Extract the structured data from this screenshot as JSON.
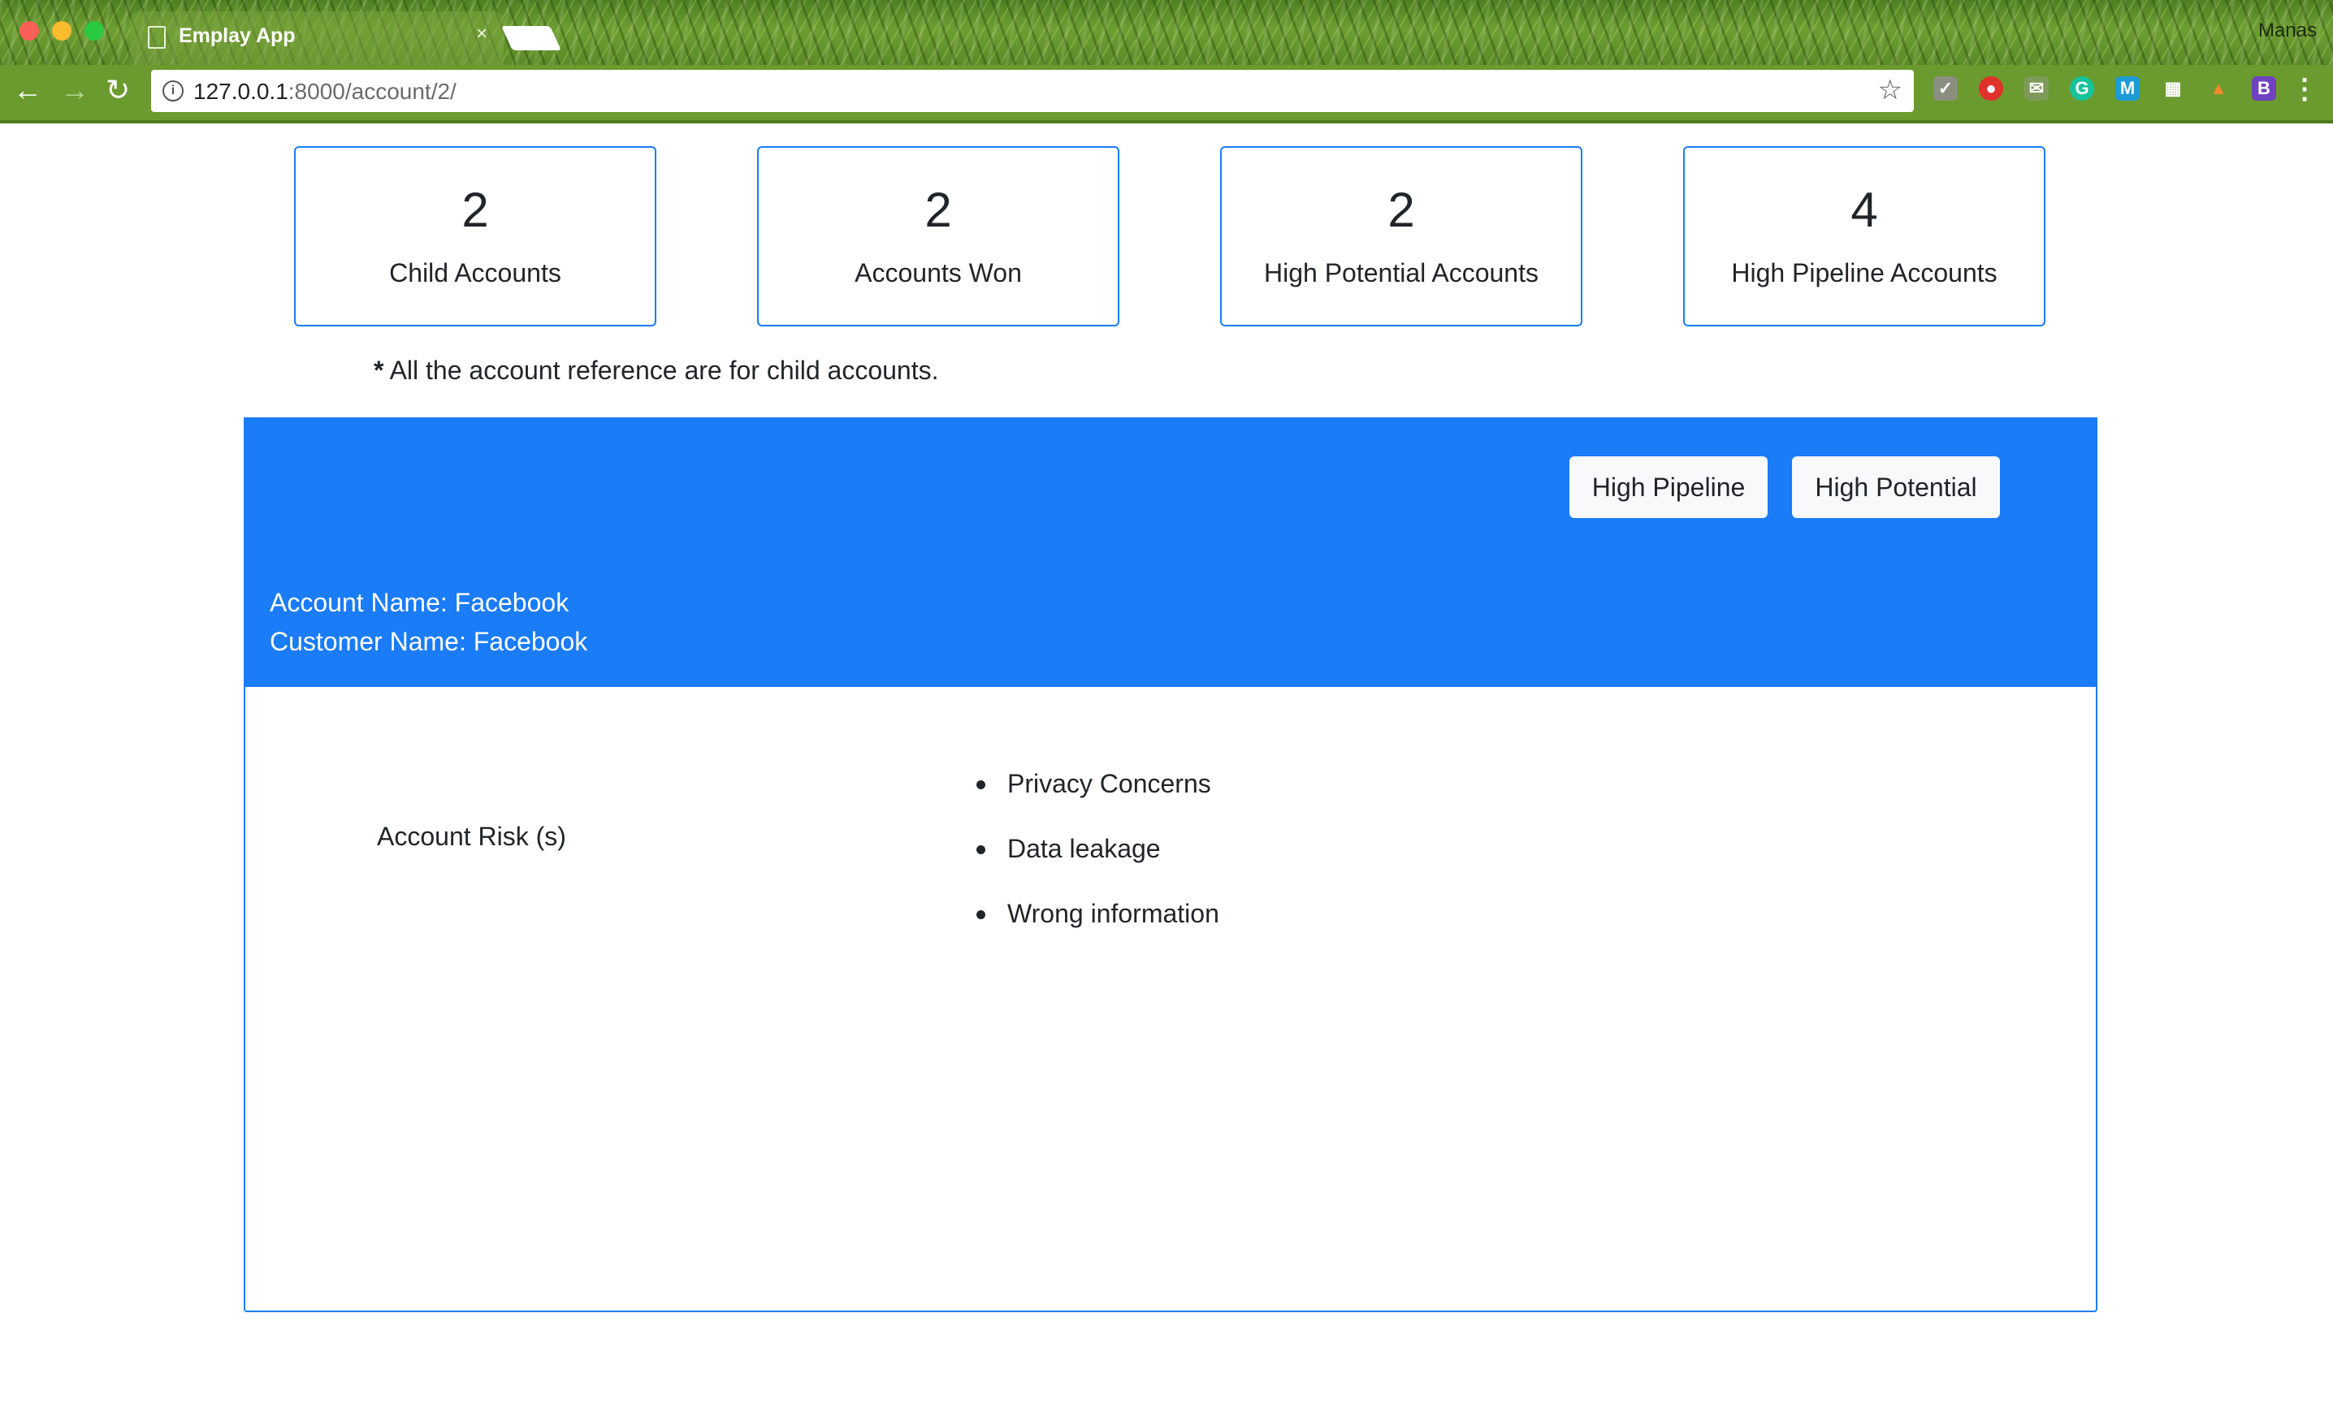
{
  "browser": {
    "tab_title": "Emplay App",
    "tab_close": "×",
    "profile_name": "Manas",
    "url_host": "127.0.0.1",
    "url_rest": ":8000/account/2/",
    "extensions": [
      "pocket-icon",
      "ublock-icon",
      "mail-icon",
      "grammarly-icon",
      "m-icon",
      "apps-grid-icon",
      "fox-icon",
      "bootstrap-icon"
    ],
    "ext_letters": {
      "grammarly": "G",
      "m": "M",
      "bootstrap": "B"
    }
  },
  "stats": [
    {
      "value": "2",
      "label": "Child Accounts"
    },
    {
      "value": "2",
      "label": "Accounts Won"
    },
    {
      "value": "2",
      "label": "High Potential Accounts"
    },
    {
      "value": "4",
      "label": "High Pipeline Accounts"
    }
  ],
  "note": {
    "asterisk": "*",
    "text": " All the account reference are for child accounts."
  },
  "account": {
    "buttons": {
      "high_pipeline": "High Pipeline",
      "high_potential": "High Potential"
    },
    "account_name_line": "Account Name: Facebook",
    "customer_name_line": "Customer Name: Facebook"
  },
  "risk": {
    "label": "Account Risk (s)",
    "items": [
      "Privacy Concerns",
      "Data leakage",
      "Wrong information"
    ]
  },
  "colors": {
    "primary": "#1a7cf6",
    "chrome_green": "#6b9a2f"
  }
}
